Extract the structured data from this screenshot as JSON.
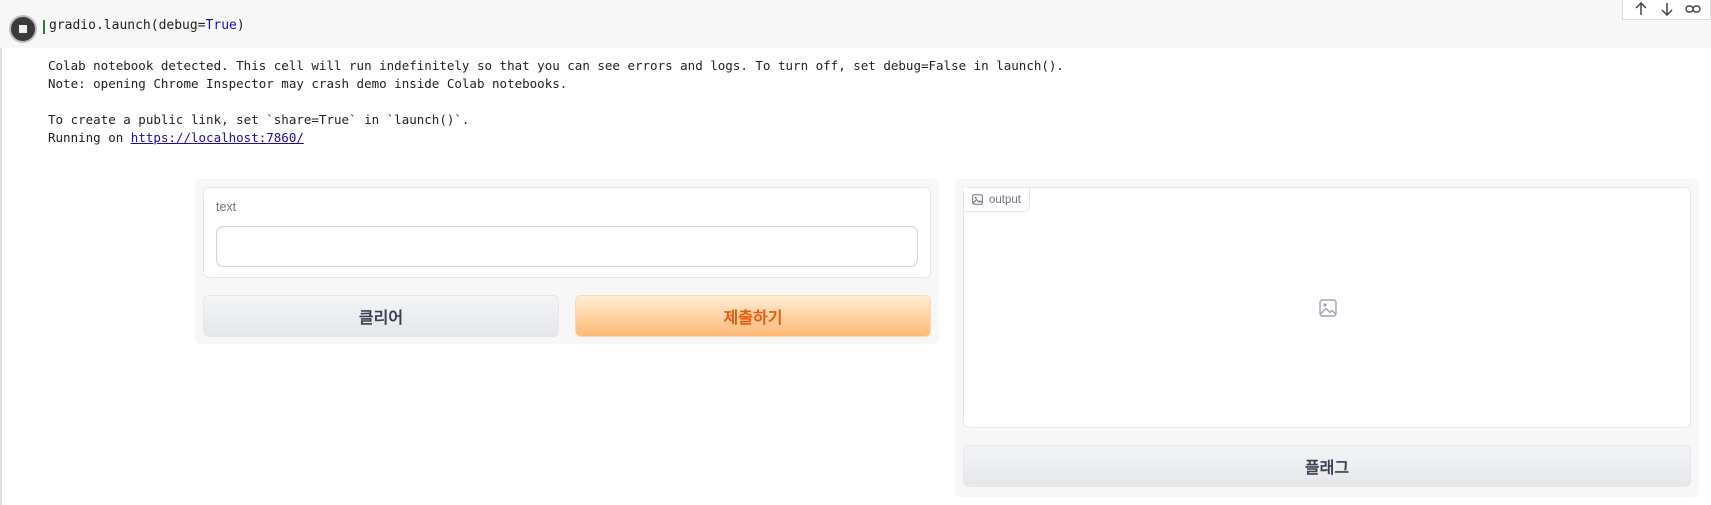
{
  "cell": {
    "code_prefix": "gradio.launch(debug=",
    "code_keyword": "True",
    "code_suffix": ")"
  },
  "output": {
    "line1": "Colab notebook detected. This cell will run indefinitely so that you can see errors and logs. To turn off, set debug=False in launch().",
    "line2": "Note: opening Chrome Inspector may crash demo inside Colab notebooks.",
    "line3": "",
    "line4": "To create a public link, set `share=True` in `launch()`.",
    "line5_prefix": "Running on ",
    "line5_link": "https://localhost:7860/"
  },
  "toolbar": {
    "icons": [
      "arrow-up-icon",
      "arrow-down-icon",
      "link-icon"
    ]
  },
  "app": {
    "text_label": "text",
    "text_value": "",
    "clear_label": "클리어",
    "submit_label": "제출하기",
    "output_label": "output",
    "flag_label": "플래그"
  },
  "colors": {
    "accent": "#ea580c",
    "submit_bg": "#fdba74",
    "link": "#1a0dab"
  }
}
